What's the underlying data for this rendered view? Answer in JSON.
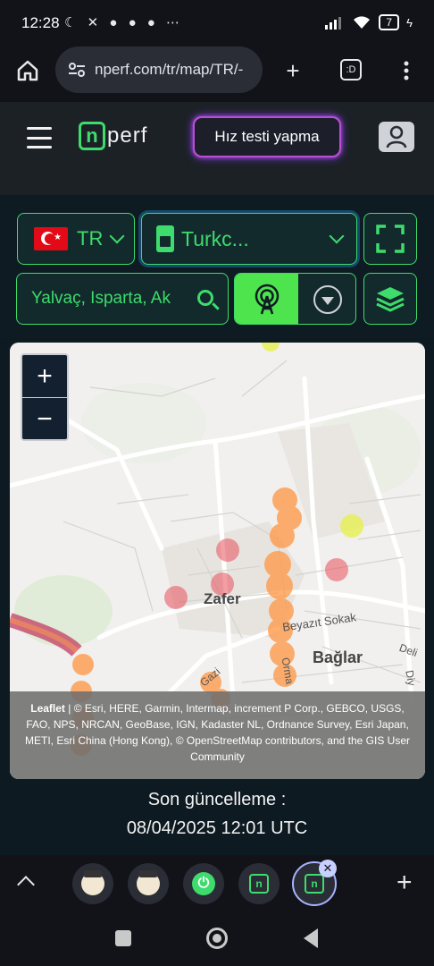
{
  "status": {
    "time": "12:28",
    "left_icons": [
      "moon-icon",
      "mute-icon",
      "snapchat-icon",
      "snapchat-icon",
      "snapchat-icon",
      "more-icon"
    ],
    "left_icons_text": "☾ ✕ ● ● ● ⋯",
    "battery": "7"
  },
  "browser": {
    "url": "nperf.com/tr/map/TR/-",
    "tab_count": ":D"
  },
  "header": {
    "logo_letter": "n",
    "logo_text": "perf",
    "speed_test_label": "Hız testi yapma"
  },
  "controls": {
    "country": "TR",
    "operator": "Turkc...",
    "search_value": "Yalvaç, Isparta, Ak"
  },
  "map": {
    "zoom_in": "+",
    "zoom_out": "−",
    "labels": {
      "zafer": "Zafer",
      "baglar": "Bağlar",
      "beyazit": "Beyazıt Sokak",
      "gaz": "Gazi",
      "dely": "Deli",
      "orma": "Orma",
      "diy": "Diy"
    },
    "attribution_leaflet": "Leaflet",
    "attribution_text": " | © Esri, HERE, Garmin, Intermap, increment P Corp., GEBCO, USGS, FAO, NPS, NRCAN, GeoBase, IGN, Kadaster NL, Ordnance Survey, Esri Japan, METI, Esri China (Hong Kong), © OpenStreetMap contributors, and the GIS User Community"
  },
  "update": {
    "title": "Son güncelleme :",
    "date": "08/04/2025 12:01 UTC"
  },
  "tabbar": {
    "plus": "+",
    "close": "✕"
  },
  "colors": {
    "accent_green": "#3ddc6c",
    "coverage_orange": "#ff9a4a",
    "coverage_red": "#e8505b",
    "coverage_yellow": "#e5f03a"
  }
}
